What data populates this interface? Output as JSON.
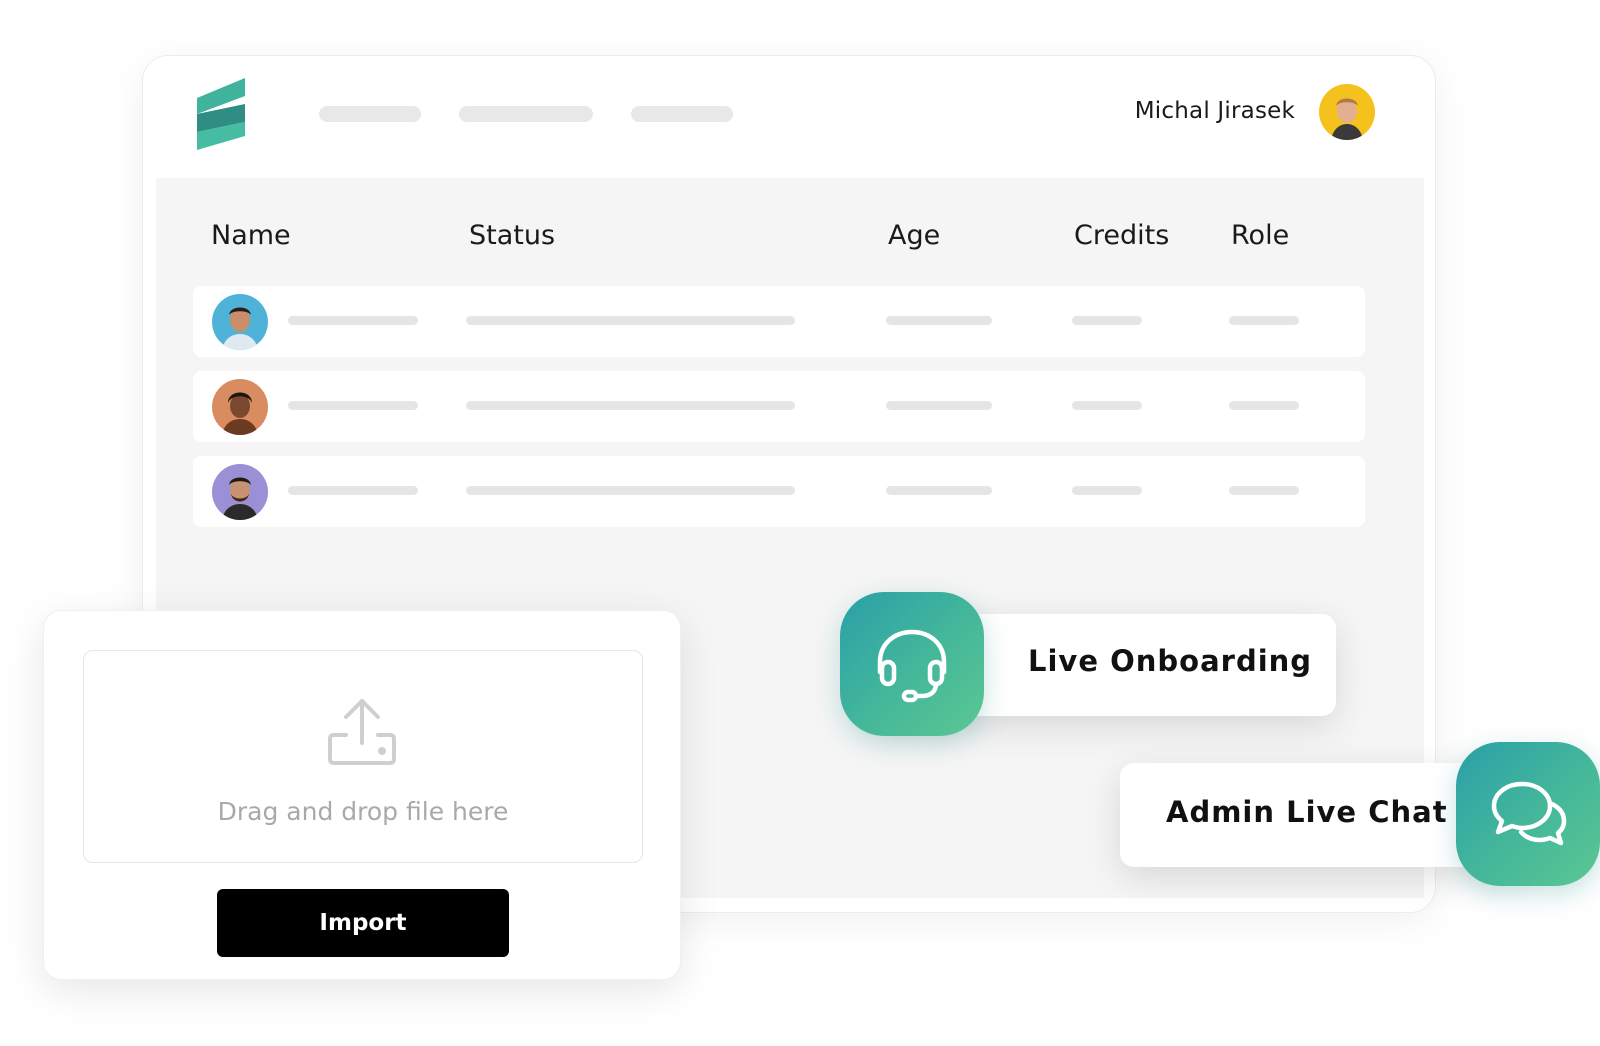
{
  "header": {
    "user_name": "Michal Jirasek"
  },
  "table": {
    "columns": [
      "Name",
      "Status",
      "Age",
      "Credits",
      "Role"
    ]
  },
  "upload": {
    "drop_text": "Drag and drop file here",
    "import_label": "Import"
  },
  "features": {
    "onboarding_label": "Live Onboarding",
    "chat_label": "Admin Live Chat"
  },
  "colors": {
    "brand_teal": "#3fb39b",
    "icon_tile": "#2fa6a3",
    "button": "#000000",
    "avatar_bg": "#f5c11d"
  }
}
